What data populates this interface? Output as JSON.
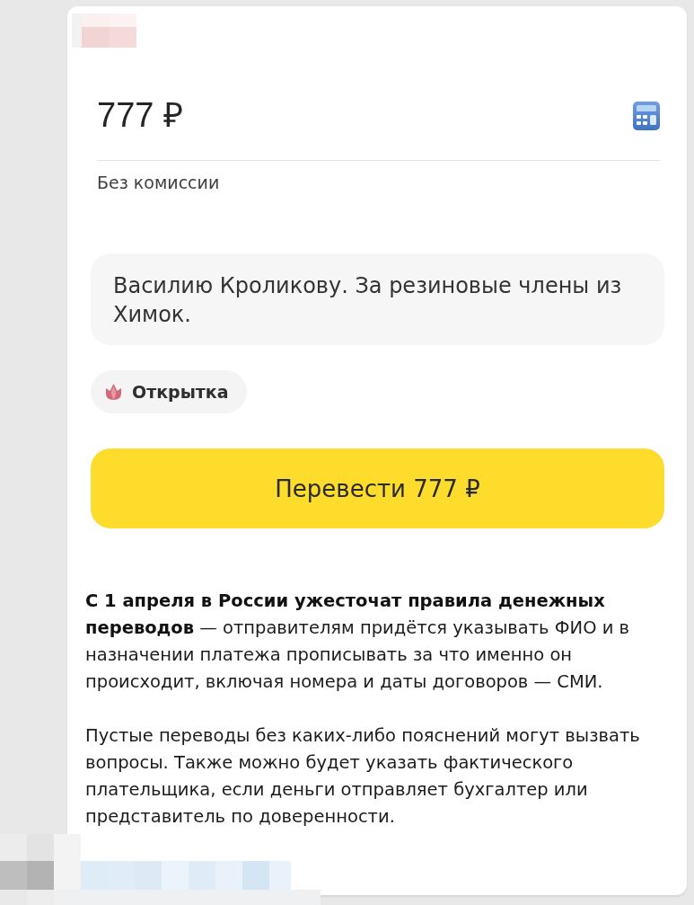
{
  "amount": {
    "value": "777 ₽"
  },
  "fee_note": "Без комиссии",
  "message": {
    "value": "Василию Кроликову. За резиновые члены из Химок."
  },
  "postcard_chip": {
    "label": "Открытка"
  },
  "transfer_button": {
    "label": "Перевести 777 ₽"
  },
  "caption": {
    "paragraphs": [
      "**С 1 апреля в России ужесточат правила денежных переводов** — отправителям придётся указывать ФИО и в назначении платежа прописывать за что именно он происходит, включая номера и даты договоров — СМИ.",
      "Пустые переводы без каких-либо пояснений могут вызвать вопросы. Также можно будет указать фактического плательщика, если деньги отправляет бухгалтер или представитель по доверенности."
    ]
  }
}
